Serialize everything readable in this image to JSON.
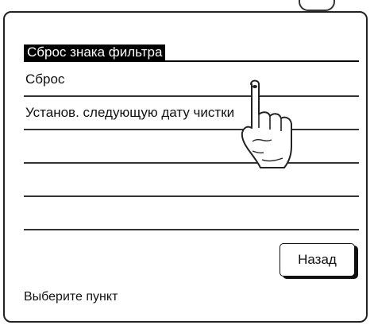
{
  "menu": {
    "title": "Сброс знака фильтра",
    "items": [
      {
        "label": "Сброс"
      },
      {
        "label": "Установ. следующую дату чистки"
      },
      {
        "label": ""
      },
      {
        "label": ""
      },
      {
        "label": ""
      }
    ]
  },
  "buttons": {
    "back_label": "Назад"
  },
  "status": {
    "text": "Выберите пункт"
  },
  "icons": {
    "pointer": "pointing-hand-icon"
  }
}
